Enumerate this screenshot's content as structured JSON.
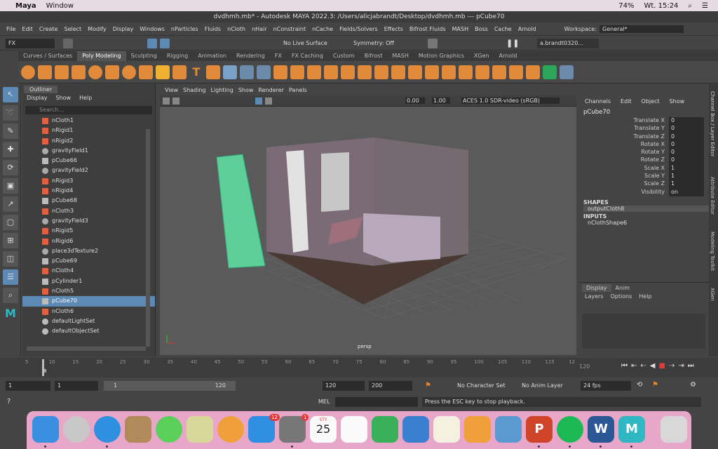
{
  "mac_menubar": {
    "app": "Maya",
    "menus": [
      "Window"
    ],
    "battery": "74%",
    "clock": "Wt. 15:24"
  },
  "window_title": "dvdhmh.mb* - Autodesk MAYA 2022.3: /Users/alicjabrandt/Desktop/dvdhmh.mb  ---  pCube70",
  "main_menu": [
    "File",
    "Edit",
    "Create",
    "Select",
    "Modify",
    "Display",
    "Windows",
    "nParticles",
    "Fluids",
    "nCloth",
    "nHair",
    "nConstraint",
    "nCache",
    "Fields/Solvers",
    "Effects",
    "Bifrost Fluids",
    "MASH",
    "Boss",
    "Cache",
    "Arnold"
  ],
  "workspace": {
    "label": "Workspace:",
    "value": "General*"
  },
  "status_line": {
    "mode": "FX",
    "live_surface": "No Live Surface",
    "symmetry": "Symmetry: Off",
    "user": "a.brandt0320..."
  },
  "shelf_tabs": [
    "Curves / Surfaces",
    "Poly Modeling",
    "Sculpting",
    "Rigging",
    "Animation",
    "Rendering",
    "FX",
    "FX Caching",
    "Custom",
    "Bifrost",
    "MASH",
    "Motion Graphics",
    "XGen",
    "Arnold"
  ],
  "active_shelf": "Poly Modeling",
  "outliner": {
    "tab": "Outliner",
    "menu": [
      "Display",
      "Show",
      "Help"
    ],
    "search_placeholder": "Search...",
    "items": [
      {
        "label": "nCloth1",
        "kind": "cloth"
      },
      {
        "label": "nRigid1",
        "kind": "rigid"
      },
      {
        "label": "nRigid2",
        "kind": "rigid"
      },
      {
        "label": "gravityField1",
        "kind": "field"
      },
      {
        "label": "pCube66",
        "kind": "mesh"
      },
      {
        "label": "gravityField2",
        "kind": "field"
      },
      {
        "label": "nRigid3",
        "kind": "rigid"
      },
      {
        "label": "nRigid4",
        "kind": "rigid"
      },
      {
        "label": "pCube68",
        "kind": "mesh"
      },
      {
        "label": "nCloth3",
        "kind": "cloth"
      },
      {
        "label": "gravityField3",
        "kind": "field"
      },
      {
        "label": "nRigid5",
        "kind": "rigid"
      },
      {
        "label": "nRigid6",
        "kind": "rigid"
      },
      {
        "label": "place3dTexture2",
        "kind": "field"
      },
      {
        "label": "pCube69",
        "kind": "mesh"
      },
      {
        "label": "nCloth4",
        "kind": "cloth"
      },
      {
        "label": "pCylinder1",
        "kind": "mesh"
      },
      {
        "label": "nCloth5",
        "kind": "cloth"
      },
      {
        "label": "pCube70",
        "kind": "mesh",
        "selected": true
      },
      {
        "label": "nCloth6",
        "kind": "cloth"
      },
      {
        "label": "defaultLightSet",
        "kind": "set"
      },
      {
        "label": "defaultObjectSet",
        "kind": "set"
      }
    ]
  },
  "viewport": {
    "menu": [
      "View",
      "Shading",
      "Lighting",
      "Show",
      "Renderer",
      "Panels"
    ],
    "exposure": "0.00",
    "gamma": "1.00",
    "color_space": "ACES 1.0 SDR-video (sRGB)",
    "camera": "persp"
  },
  "channel_box": {
    "menu": [
      "Channels",
      "Edit",
      "Object",
      "Show"
    ],
    "object": "pCube70",
    "attributes": [
      {
        "name": "Translate X",
        "value": "0"
      },
      {
        "name": "Translate Y",
        "value": "0"
      },
      {
        "name": "Translate Z",
        "value": "0"
      },
      {
        "name": "Rotate X",
        "value": "0"
      },
      {
        "name": "Rotate Y",
        "value": "0"
      },
      {
        "name": "Rotate Z",
        "value": "0"
      },
      {
        "name": "Scale X",
        "value": "1"
      },
      {
        "name": "Scale Y",
        "value": "1"
      },
      {
        "name": "Scale Z",
        "value": "1"
      },
      {
        "name": "Visibility",
        "value": "on"
      }
    ],
    "shapes_label": "SHAPES",
    "shape": "outputCloth8",
    "inputs_label": "INPUTS",
    "input": "nClothShape6"
  },
  "layer_editor": {
    "tabs": [
      "Display",
      "Anim"
    ],
    "menu": [
      "Layers",
      "Options",
      "Help"
    ]
  },
  "right_tabs": [
    "Channel Box / Layer Editor",
    "Attribute Editor",
    "Modeling Toolkit",
    "XGen"
  ],
  "timeline": {
    "ticks": [
      "5",
      "10",
      "15",
      "20",
      "25",
      "30",
      "35",
      "40",
      "45",
      "50",
      "55",
      "60",
      "65",
      "70",
      "75",
      "80",
      "85",
      "90",
      "95",
      "100",
      "105",
      "110",
      "115",
      "12"
    ],
    "current_frame": "8",
    "end_display": "120"
  },
  "range": {
    "start": "1",
    "anim_start": "1",
    "slider_start": "1",
    "slider_end": "120",
    "end": "120",
    "anim_end": "200",
    "character_set": "No Character Set",
    "anim_layer": "No Anim Layer",
    "fps": "24 fps"
  },
  "command_line": {
    "label": "MEL",
    "feedback": "Press the ESC key to stop playback."
  },
  "dock": {
    "calendar_month": "STY",
    "calendar_day": "25",
    "mail_badge": "",
    "appstore_badge": "12",
    "prefs_badge": "1"
  }
}
